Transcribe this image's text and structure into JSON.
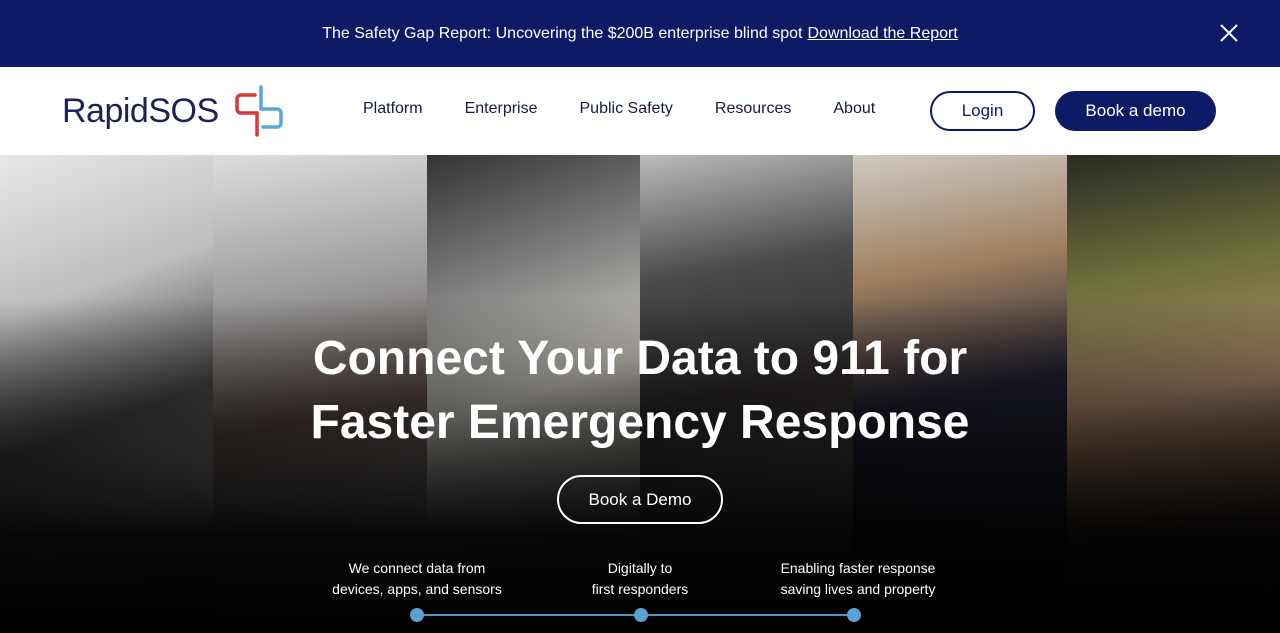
{
  "banner": {
    "text": "The Safety Gap Report: Uncovering the $200B enterprise blind spot",
    "link": "Download the Report"
  },
  "logo": {
    "text": "RapidSOS",
    "colors": {
      "red": "#d9393a",
      "blue": "#5aa6d8"
    }
  },
  "nav": {
    "items": [
      "Platform",
      "Enterprise",
      "Public Safety",
      "Resources",
      "About"
    ],
    "login": "Login",
    "book_demo": "Book a demo"
  },
  "hero": {
    "headline_line1": "Connect Your Data to 911 for",
    "headline_line2": "Faster Emergency Response",
    "cta": "Book a Demo",
    "steps": [
      {
        "line1": "We connect data from",
        "line2": "devices, apps, and sensors"
      },
      {
        "line1": "Digitally to",
        "line2": "first responders"
      },
      {
        "line1": "Enabling faster response",
        "line2": "saving lives and property"
      }
    ]
  },
  "colors": {
    "navy": "#0d1b66",
    "accent_blue": "#5aa1d4"
  }
}
